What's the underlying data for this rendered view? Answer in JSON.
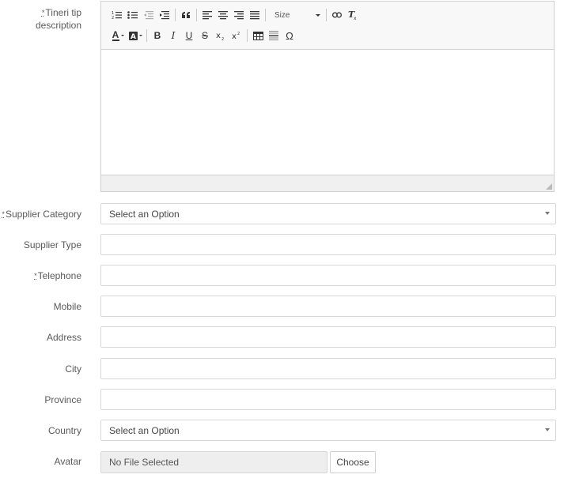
{
  "form": {
    "description": {
      "required_mark": "*",
      "label": "Tineri tip description"
    },
    "supplier_category": {
      "required_mark": "*",
      "label": "Supplier Category",
      "value": "Select an Option"
    },
    "supplier_type": {
      "label": "Supplier Type",
      "value": ""
    },
    "telephone": {
      "required_mark": "*",
      "label": "Telephone",
      "value": ""
    },
    "mobile": {
      "label": "Mobile",
      "value": ""
    },
    "address": {
      "label": "Address",
      "value": ""
    },
    "city": {
      "label": "City",
      "value": ""
    },
    "province": {
      "label": "Province",
      "value": ""
    },
    "country": {
      "label": "Country",
      "value": "Select an Option"
    },
    "avatar": {
      "label": "Avatar",
      "file_text": "No File Selected",
      "choose_label": "Choose"
    }
  },
  "editor_toolbar": {
    "size_label": "Size",
    "row1_icons": [
      "numbered-list-icon",
      "bullet-list-icon",
      "outdent-icon",
      "indent-icon",
      "blockquote-icon",
      "align-left-icon",
      "align-center-icon",
      "align-right-icon",
      "justify-icon",
      "size-dropdown",
      "link-icon",
      "remove-format-icon"
    ],
    "row2_icons": [
      "text-color-icon",
      "background-color-icon",
      "bold-icon",
      "italic-icon",
      "underline-icon",
      "strikethrough-icon",
      "subscript-icon",
      "superscript-icon",
      "table-icon",
      "horizontal-rule-icon",
      "special-char-icon"
    ],
    "glyphs": {
      "bold": "B",
      "italic": "I",
      "underline": "U",
      "strike": "S",
      "omega": "Ω",
      "color_a": "A"
    }
  }
}
